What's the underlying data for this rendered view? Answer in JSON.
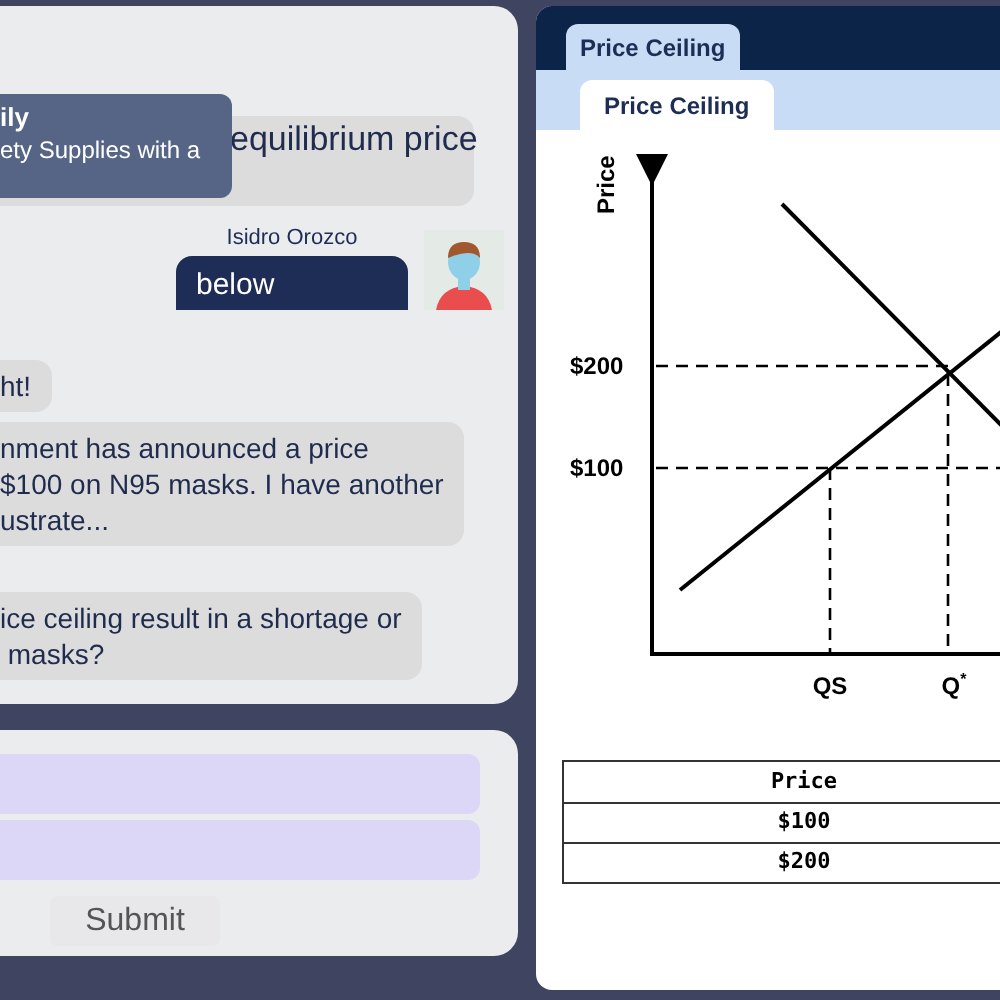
{
  "chat": {
    "messages": [
      {
        "kind": "bot",
        "text": "equilibrium price"
      },
      {
        "kind": "user",
        "author": "Isidro Orozco",
        "text": "below"
      },
      {
        "kind": "bot",
        "text": "ht!"
      },
      {
        "kind": "bot",
        "text": "nment has announced a price\n$100 on N95 masks. I have another\nustrate..."
      },
      {
        "kind": "bot",
        "text": "ice ceiling result in a shortage or\n masks?"
      }
    ]
  },
  "tooltip": {
    "title": "ily",
    "text": "ety Supplies with a"
  },
  "submit": "Submit",
  "panel": {
    "tab": "Price Ceiling",
    "subtab": "Price Ceiling"
  },
  "diagram": {
    "ylabel": "Price",
    "price_labels": [
      "$200",
      "$100"
    ],
    "quantity_labels": [
      "QS",
      "Q$^{*}$"
    ]
  },
  "table": {
    "columns": [
      "Price"
    ],
    "rows": [
      [
        "$100"
      ],
      [
        "$200"
      ]
    ]
  }
}
